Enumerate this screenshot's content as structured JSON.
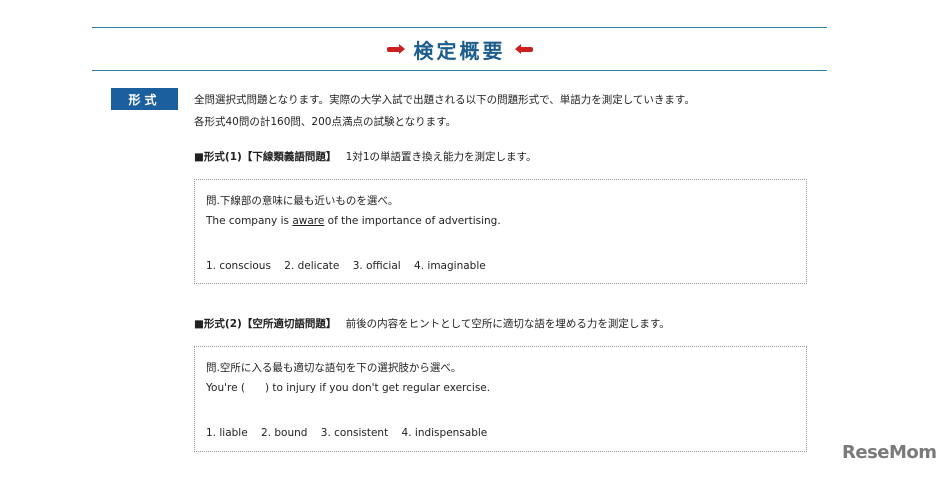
{
  "header": {
    "title": "検定概要"
  },
  "section": {
    "badge": "形式",
    "intro_lines": [
      "全問選択式問題となります。実際の大学入試で出題される以下の問題形式で、単語力を測定していきます。",
      "各形式40問の計160問、200点満点の試験となります。"
    ]
  },
  "formats": [
    {
      "label": "■形式(1)【下線類義語問題】",
      "description": "1対1の単語置き換え能力を測定します。",
      "prompt": "問.下線部の意味に最も近いものを選べ。",
      "sentence_before": "The company is ",
      "sentence_underlined": "aware",
      "sentence_after": " of the importance of advertising.",
      "choices": [
        "1. conscious",
        "2. delicate",
        "3. official",
        "4. imaginable"
      ]
    },
    {
      "label": "■形式(2)【空所適切語問題】",
      "description": "前後の内容をヒントとして空所に適切な語を埋める力を測定します。",
      "prompt": "問.空所に入る最も適切な語句を下の選択肢から選べ。",
      "sentence": "You're (      ) to injury if you don't get regular exercise.",
      "choices": [
        "1. liable",
        "2. bound",
        "3. consistent",
        "4. indispensable"
      ]
    }
  ],
  "watermark": {
    "text": "ReseMom"
  },
  "colors": {
    "accent_blue": "#1b5f9e",
    "arrow_red": "#cc1f1f",
    "rule": "#2a7fa5"
  }
}
